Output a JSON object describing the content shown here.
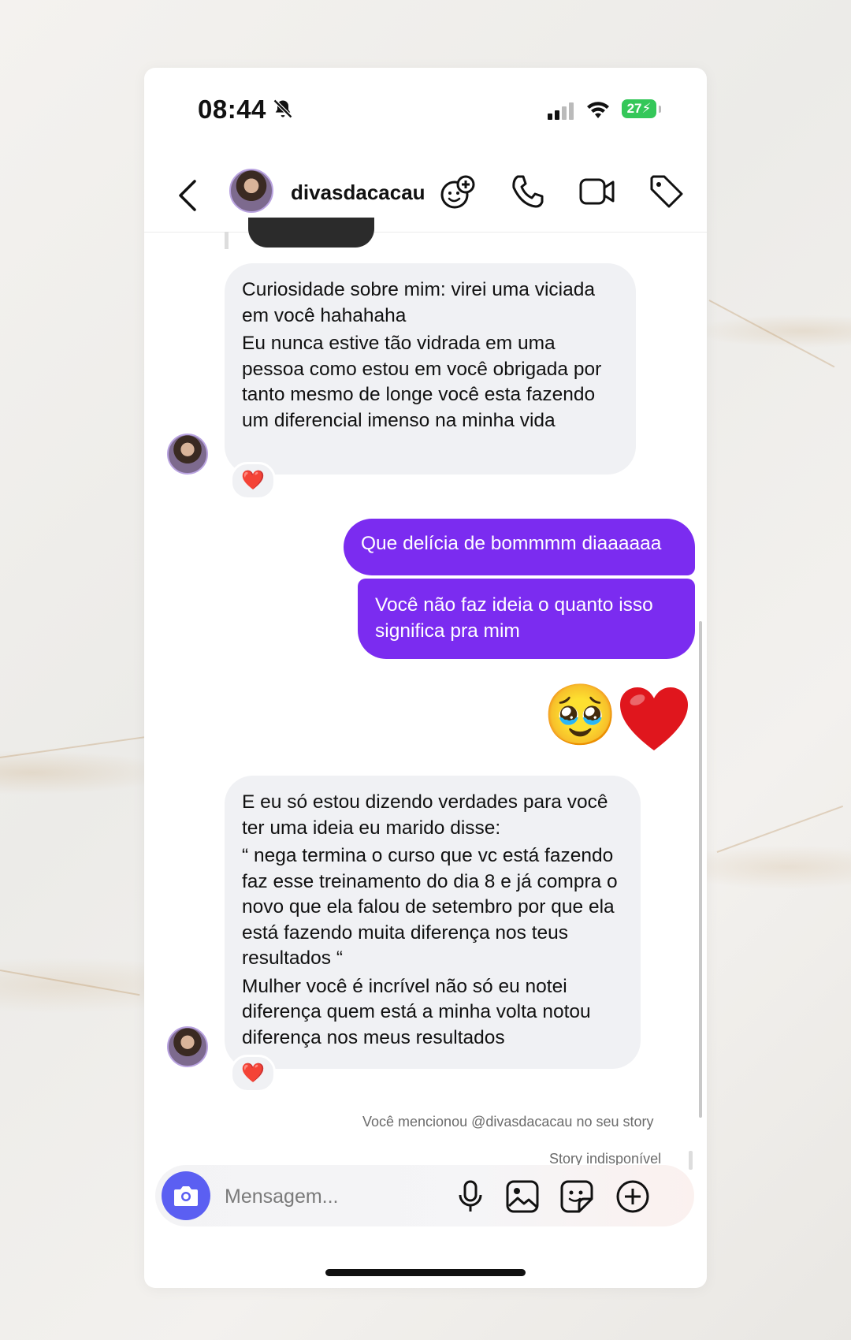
{
  "status_bar": {
    "time": "08:44",
    "battery": "27",
    "icons": [
      "bell-slash-icon",
      "signal-icon",
      "wifi-icon",
      "battery-charging-icon"
    ]
  },
  "header": {
    "username": "divasdacacau",
    "icons": [
      "back-icon",
      "add-reaction-icon",
      "phone-icon",
      "video-icon",
      "tag-icon"
    ]
  },
  "messages": {
    "m1": {
      "p1": "Curiosidade sobre mim: virei uma viciada em você hahahaha",
      "p2": "Eu nunca estive tão vidrada em uma pessoa como estou em você obrigada por tanto mesmo de longe você esta fazendo um diferencial imenso na minha vida",
      "reaction": "❤️"
    },
    "m2": {
      "text": "Que delícia de bommmm diaaaaaa"
    },
    "m3": {
      "text": "Você não faz ideia o quanto isso significa pra mim"
    },
    "m4": {
      "emoji1": "🥹",
      "emoji2": "❤️"
    },
    "m5": {
      "p1": "E eu só estou dizendo verdades para você ter uma ideia eu marido disse:",
      "p2": "“ nega termina o curso que vc está fazendo faz esse treinamento do dia 8 e já compra o novo que ela falou de setembro por que ela está fazendo muita diferença nos teus resultados “",
      "p3": "Mulher você é incrível não só eu notei diferença quem está a minha volta notou diferença nos meus resultados",
      "reaction": "❤️"
    }
  },
  "story_note": "Você mencionou @divasdacacau no seu story",
  "story_unavailable": "Story indisponível",
  "composer": {
    "placeholder": "Mensagem...",
    "icons": [
      "camera-icon",
      "microphone-icon",
      "gallery-icon",
      "sticker-icon",
      "plus-circle-icon"
    ]
  },
  "colors": {
    "outgoing_bubble": "#7b2cf0",
    "incoming_bubble": "#f0f1f4",
    "camera_button": "#5b5ff2",
    "battery": "#34c759"
  }
}
